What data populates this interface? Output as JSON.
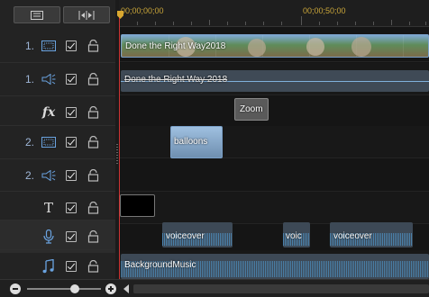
{
  "toolbar": {
    "icons": [
      "storyboard-view-icon",
      "fit-timeline-icon"
    ]
  },
  "ruler": {
    "time_start": "00;00;00;00",
    "time_mid": "00;00;50;00"
  },
  "tracks": [
    {
      "number": "1.",
      "type": "video",
      "icon": "video-track-icon",
      "enabled": true,
      "locked": false
    },
    {
      "number": "1.",
      "type": "audio",
      "icon": "audio-track-icon",
      "enabled": true,
      "locked": false
    },
    {
      "number": "",
      "type": "effect",
      "icon": "fx-icon",
      "icon_text": "fx",
      "enabled": true,
      "locked": false
    },
    {
      "number": "2.",
      "type": "video",
      "icon": "video-track-icon",
      "enabled": true,
      "locked": false
    },
    {
      "number": "2.",
      "type": "audio",
      "icon": "audio-track-icon",
      "enabled": true,
      "locked": false
    },
    {
      "number": "",
      "type": "title",
      "icon": "title-t-icon",
      "icon_text": "T",
      "enabled": true,
      "locked": false
    },
    {
      "number": "",
      "type": "voice",
      "icon": "microphone-icon",
      "enabled": true,
      "locked": false
    },
    {
      "number": "",
      "type": "music",
      "icon": "music-note-icon",
      "enabled": true,
      "locked": false
    }
  ],
  "clips": {
    "video1": "Done the Right Way2018",
    "audio1": "Done the Right Way 2018",
    "effect": "Zoom",
    "video2": "balloons",
    "voice1": "voiceover",
    "voice2": "voic",
    "voice3": "voiceover",
    "music": "BackgroundMusic"
  },
  "colors": {
    "playhead": "#cc3333",
    "ruler_text": "#c9a53a",
    "track_number": "#9fb7d8",
    "video_clip_border": "#7aa0c8",
    "audio_wave": "#4d8fc0"
  },
  "zoom": {
    "level": 0.8
  }
}
